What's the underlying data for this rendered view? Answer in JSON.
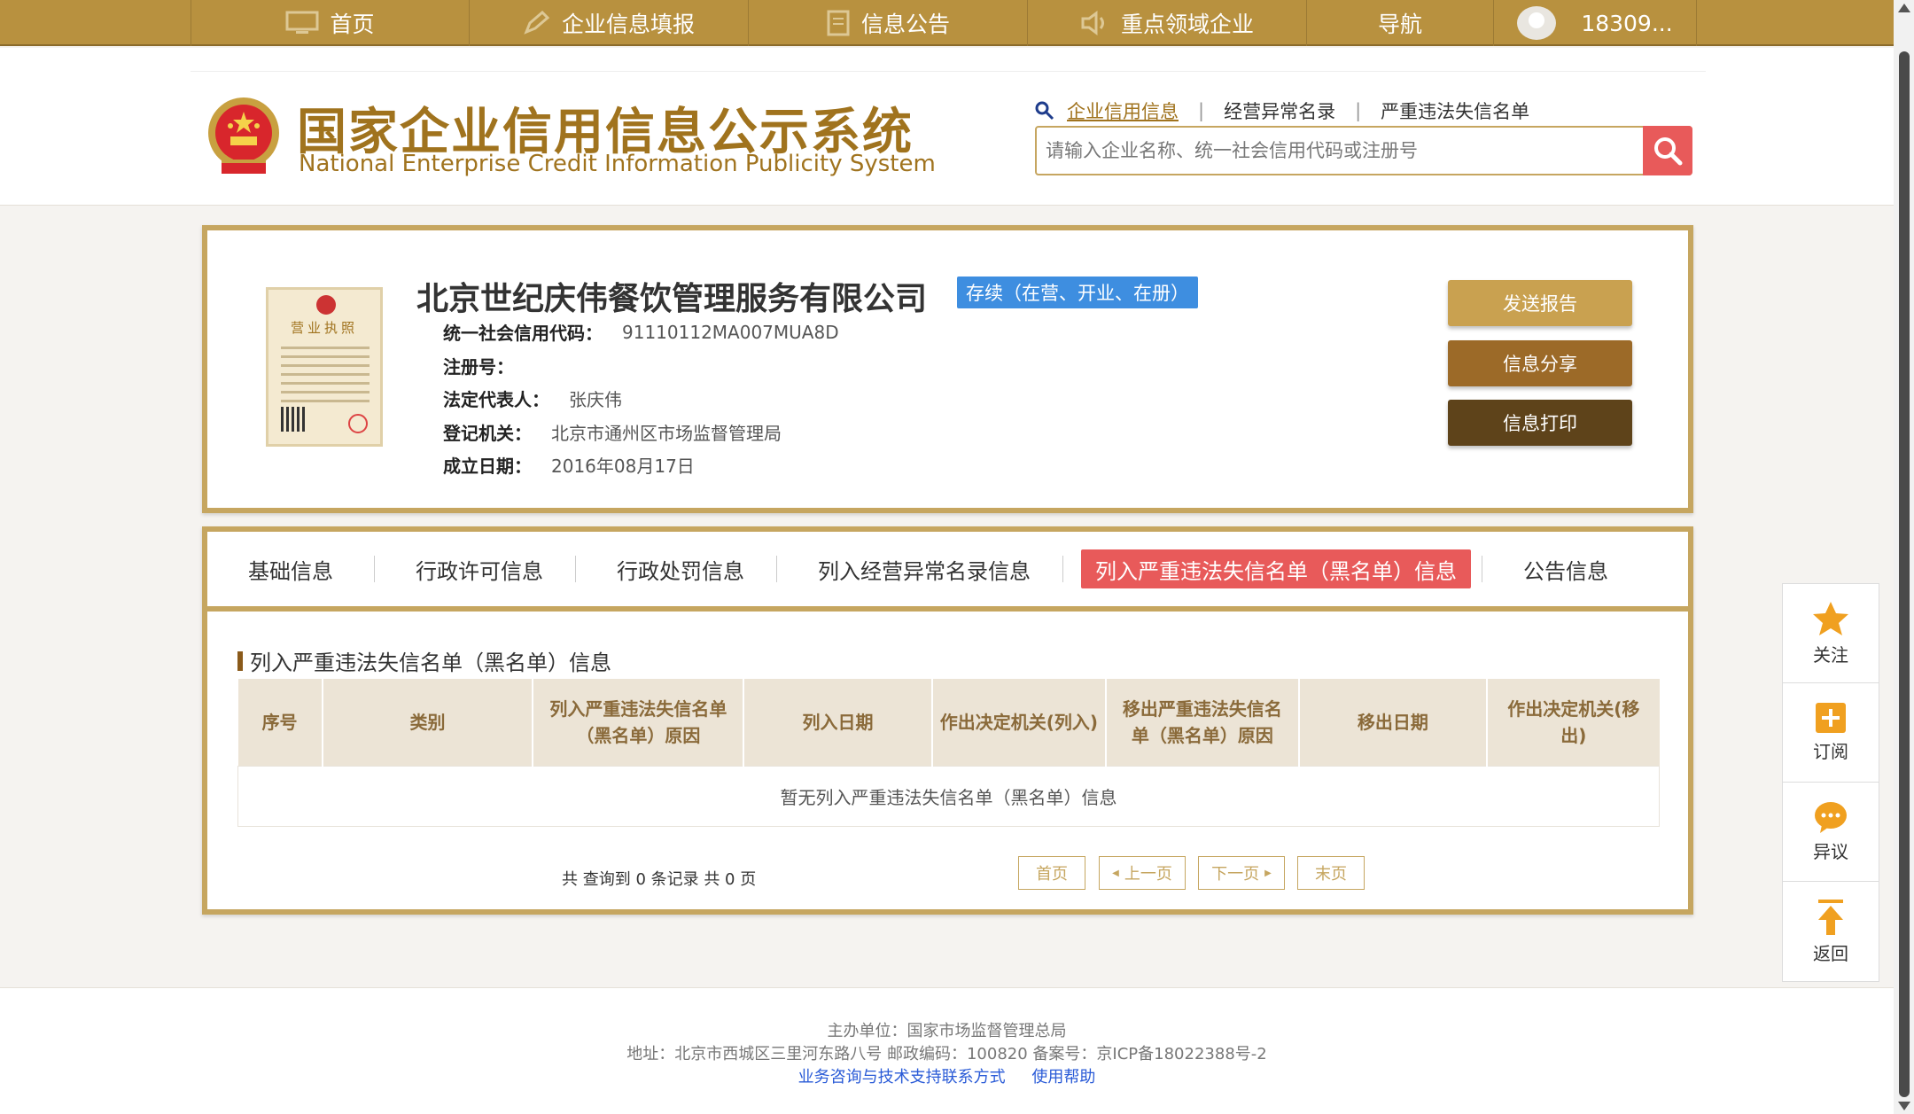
{
  "topnav": {
    "items": [
      {
        "label": "首页",
        "icon": "monitor-icon"
      },
      {
        "label": "企业信息填报",
        "icon": "edit-icon"
      },
      {
        "label": "信息公告",
        "icon": "document-icon"
      },
      {
        "label": "重点领域企业",
        "icon": "speaker-icon"
      },
      {
        "label": "导航",
        "icon": ""
      }
    ],
    "user": "18309..."
  },
  "header": {
    "logo_cn": "国家企业信用信息公示系统",
    "logo_en": "National Enterprise Credit Information Publicity System",
    "search_tabs": [
      "企业信用信息",
      "经营异常名录",
      "严重违法失信名单"
    ],
    "search_tab_sep": "|",
    "search_placeholder": "请输入企业名称、统一社会信用代码或注册号"
  },
  "company": {
    "license_title": "营业执照",
    "name": "北京世纪庆伟餐饮管理服务有限公司",
    "status": "存续（在营、开业、在册）",
    "fields": [
      {
        "key": "统一社会信用代码：",
        "value": "91110112MA007MUA8D"
      },
      {
        "key": "注册号：",
        "value": ""
      },
      {
        "key": "法定代表人：",
        "value": "张庆伟"
      },
      {
        "key": "登记机关：",
        "value": "北京市通州区市场监督管理局"
      },
      {
        "key": "成立日期：",
        "value": "2016年08月17日"
      }
    ],
    "buttons": [
      "发送报告",
      "信息分享",
      "信息打印"
    ]
  },
  "tabs": [
    "基础信息",
    "行政许可信息",
    "行政处罚信息",
    "列入经营异常名录信息",
    "列入严重违法失信名单（黑名单）信息",
    "公告信息"
  ],
  "active_tab": 4,
  "section": {
    "title": "列入严重违法失信名单（黑名单）信息",
    "columns": [
      "序号",
      "类别",
      "列入严重违法失信名单（黑名单）原因",
      "列入日期",
      "作出决定机关(列入)",
      "移出严重违法失信名单（黑名单）原因",
      "移出日期",
      "作出决定机关(移出)"
    ],
    "empty_text": "暂无列入严重违法失信名单（黑名单）信息",
    "record_count": "共 查询到 0 条记录 共 0 页",
    "pager": [
      "首页",
      "上一页",
      "下一页",
      "末页"
    ]
  },
  "footer": {
    "host": "主办单位：国家市场监督管理总局",
    "address": "地址：北京市西城区三里河东路八号   邮政编码：100820   备案号：京ICP备18022388号-2",
    "link_contact": "业务咨询与技术支持联系方式",
    "link_help": "使用帮助"
  },
  "sidefloat": [
    "关注",
    "订阅",
    "异议",
    "返回"
  ],
  "colors": {
    "gold": "#b8913f",
    "border_gold": "#c6a660",
    "active_red": "#e85a5a",
    "status_blue": "#3e8ee0",
    "btn_send": "#c9a150",
    "btn_share": "#9c6a28",
    "btn_print": "#5e431a"
  }
}
